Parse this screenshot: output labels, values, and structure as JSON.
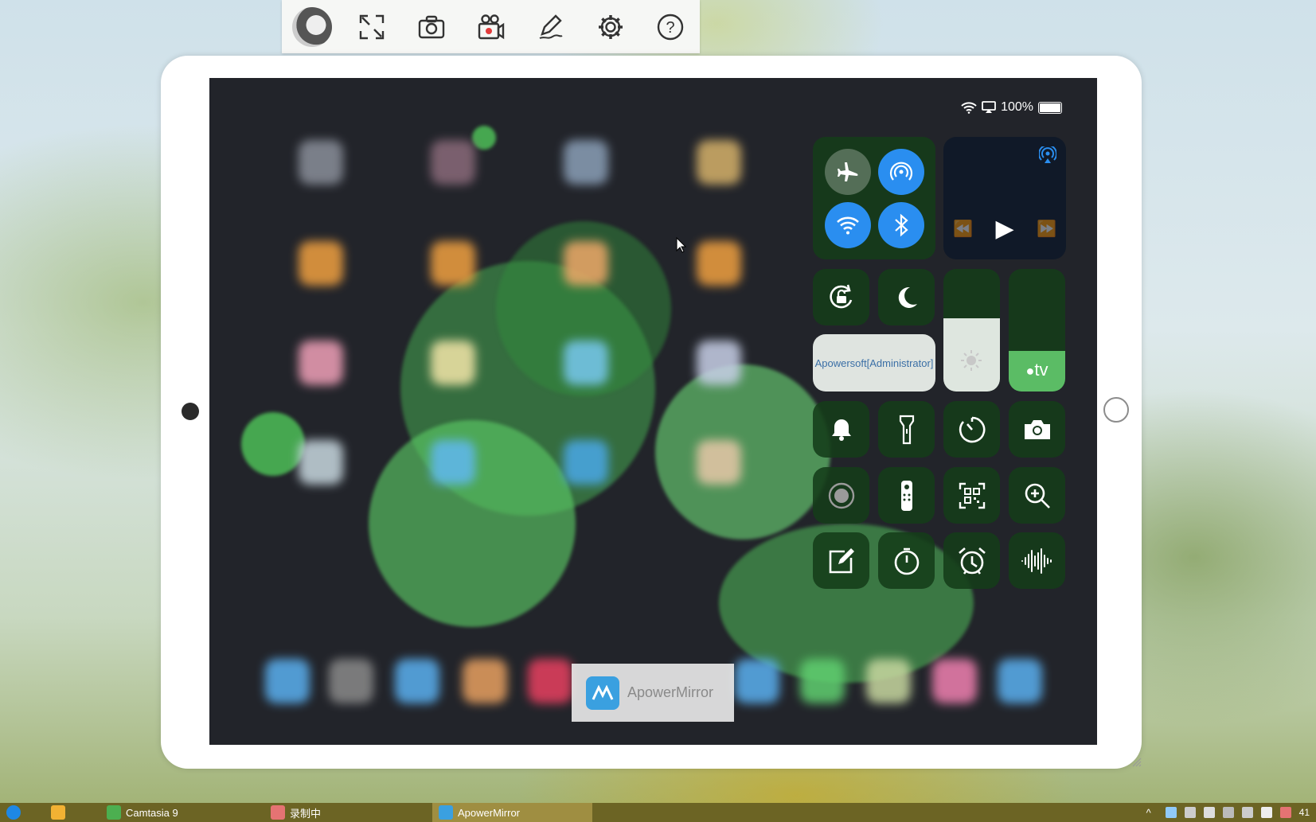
{
  "toolbar": {
    "buttons": [
      {
        "name": "avatar"
      },
      {
        "name": "fullscreen-icon"
      },
      {
        "name": "screenshot-camera-icon"
      },
      {
        "name": "record-video-icon"
      },
      {
        "name": "annotate-pen-icon"
      },
      {
        "name": "settings-gear-icon"
      },
      {
        "name": "help-icon"
      }
    ]
  },
  "status_bar": {
    "battery": "100%"
  },
  "control_center": {
    "airplay_target_label": "Apowersoft[Administrator]",
    "apple_tv_label": "tv",
    "media": {
      "rewind": "⏪",
      "play": "▶",
      "forward": "⏩"
    },
    "colors": {
      "accent_blue": "#2a8ef0",
      "tile_bg": "#14391a"
    }
  },
  "watermark": {
    "label": "ApowerMirror"
  },
  "taskbar": {
    "items": [
      {
        "label": ""
      },
      {
        "label": ""
      },
      {
        "label": "Camtasia 9"
      },
      {
        "label": "录制中"
      },
      {
        "label": "ApowerMirror"
      }
    ],
    "clock_hint": "41"
  }
}
